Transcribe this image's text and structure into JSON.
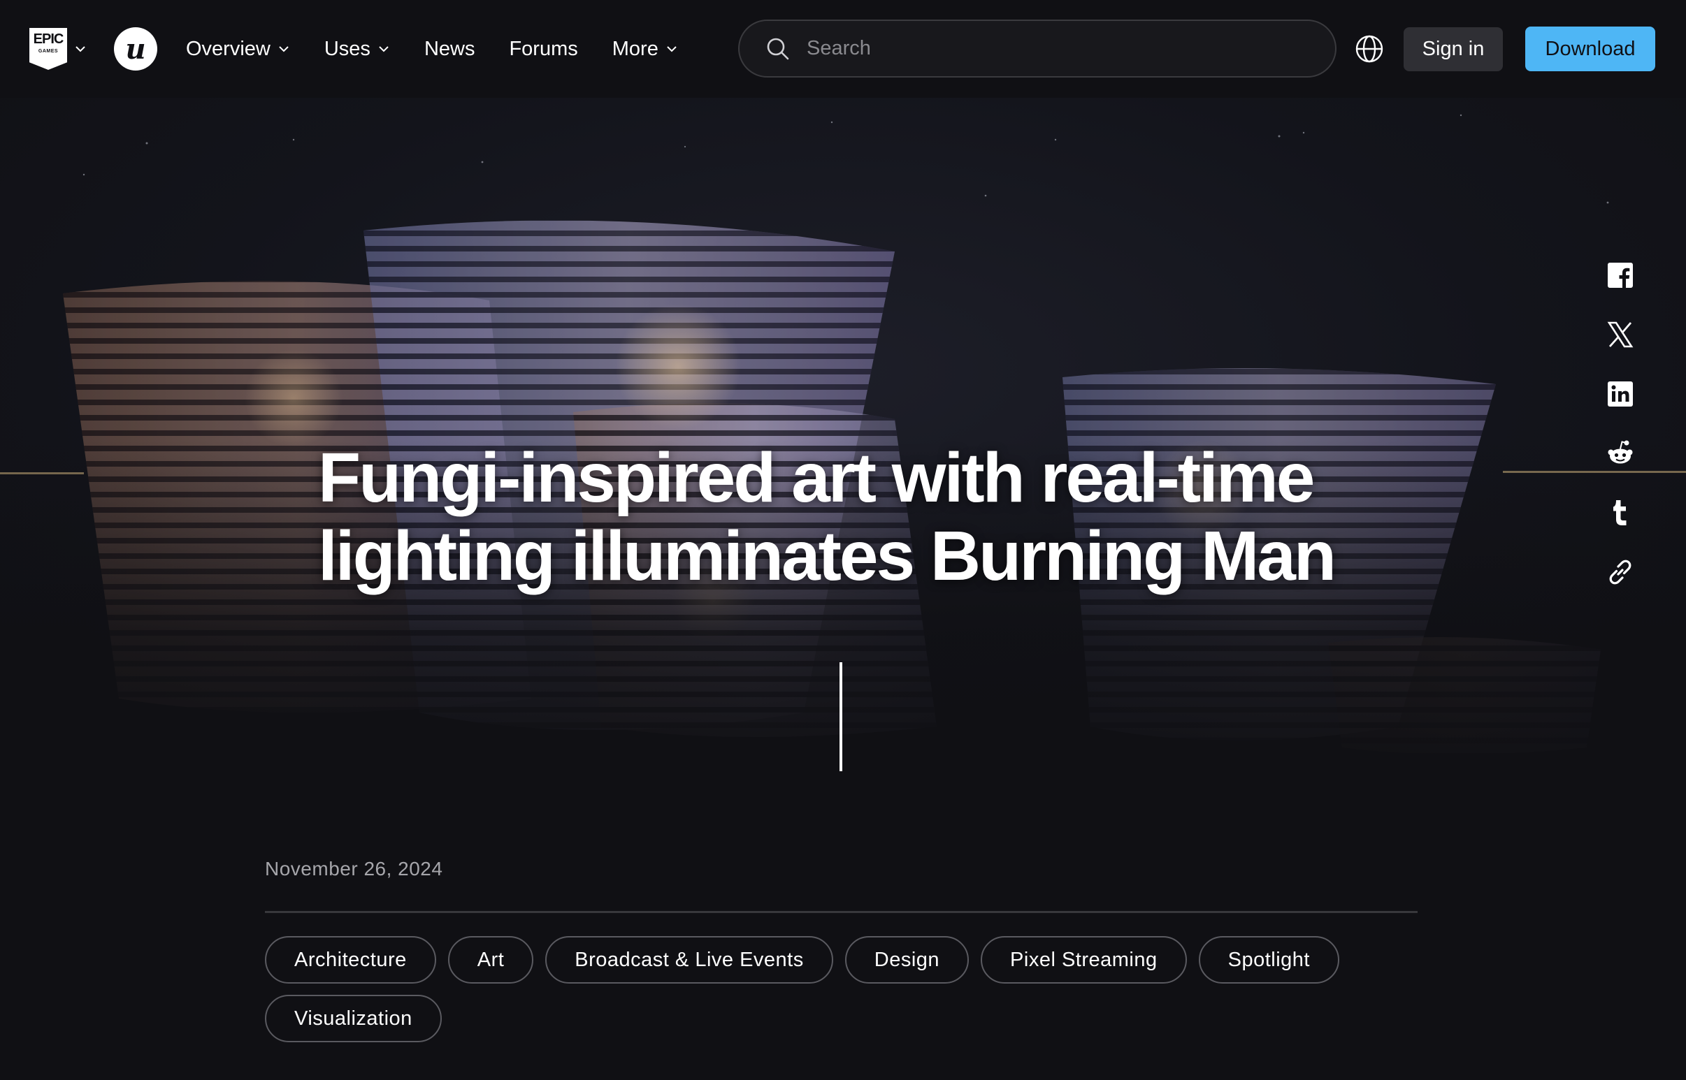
{
  "header": {
    "epic_logo": {
      "line1": "EPIC",
      "line2": "GAMES"
    },
    "ue_logo": "u",
    "nav": [
      {
        "label": "Overview",
        "has_dropdown": true
      },
      {
        "label": "Uses",
        "has_dropdown": true
      },
      {
        "label": "News",
        "has_dropdown": false
      },
      {
        "label": "Forums",
        "has_dropdown": false
      },
      {
        "label": "More",
        "has_dropdown": true
      }
    ],
    "search": {
      "placeholder": "Search",
      "value": ""
    },
    "signin_label": "Sign in",
    "download_label": "Download",
    "colors": {
      "background": "#101014",
      "download": "#4eb6f5",
      "signin": "#2f2f34"
    }
  },
  "hero": {
    "title": "Fungi-inspired art with real-time lighting illuminates Burning Man"
  },
  "share": {
    "icons": [
      "facebook-icon",
      "x-icon",
      "linkedin-icon",
      "reddit-icon",
      "tumblr-icon",
      "copy-link-icon"
    ]
  },
  "article": {
    "date": "November 26, 2024",
    "tags": [
      "Architecture",
      "Art",
      "Broadcast & Live Events",
      "Design",
      "Pixel Streaming",
      "Spotlight",
      "Visualization"
    ]
  }
}
